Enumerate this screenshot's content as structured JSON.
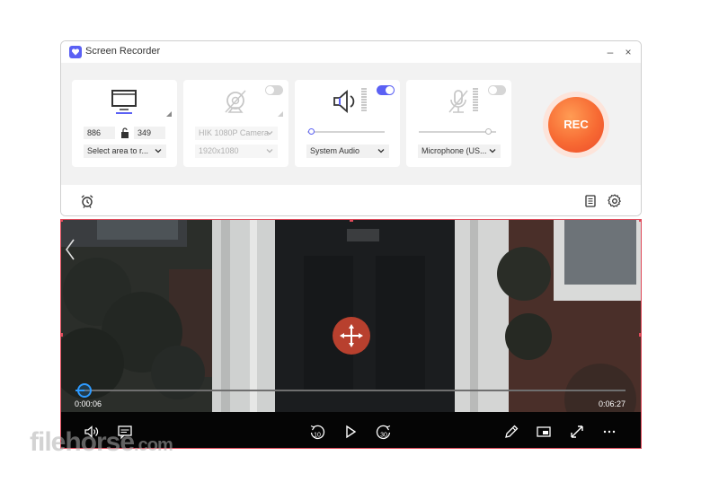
{
  "window": {
    "title": "Screen Recorder",
    "minimize_glyph": "–",
    "maximize_glyph": "□",
    "close_glyph": "×"
  },
  "display_card": {
    "icon": "monitor-icon",
    "width_value": "886",
    "height_value": "349",
    "area_select": "Select area to r...",
    "lock_icon": "unlock-icon"
  },
  "webcam_card": {
    "icon": "webcam-off-icon",
    "enabled": false,
    "camera_select": "HIK 1080P Camera",
    "resolution_select": "1920x1080"
  },
  "system_audio_card": {
    "icon": "speaker-icon",
    "enabled": true,
    "volume_level": 0.05,
    "source_select": "System Audio"
  },
  "microphone_card": {
    "icon": "microphone-off-icon",
    "enabled": false,
    "volume_level": 0.9,
    "source_select": "Microphone (US..."
  },
  "rec_button": {
    "label": "REC"
  },
  "bottom_bar": {
    "left_icon": "alarm-clock-icon",
    "right_icons": [
      "list-icon",
      "gear-icon"
    ]
  },
  "player": {
    "current_time": "0:00:06",
    "total_time": "0:06:27",
    "progress": 0.016,
    "rewind_label": "10",
    "forward_label": "30",
    "icons": [
      "volume-icon",
      "subtitles-icon",
      "rewind-10-icon",
      "play-icon",
      "forward-30-icon",
      "edit-icon",
      "picture-in-picture-icon",
      "fullscreen-icon",
      "more-icon"
    ]
  },
  "colors": {
    "accent": "#5b61f4",
    "rec_orange": "#f76a33",
    "selection_border": "#e04b5b",
    "seek_blue": "#2e9bff"
  },
  "watermark": {
    "text": "filehorse",
    "tld": ".com"
  }
}
